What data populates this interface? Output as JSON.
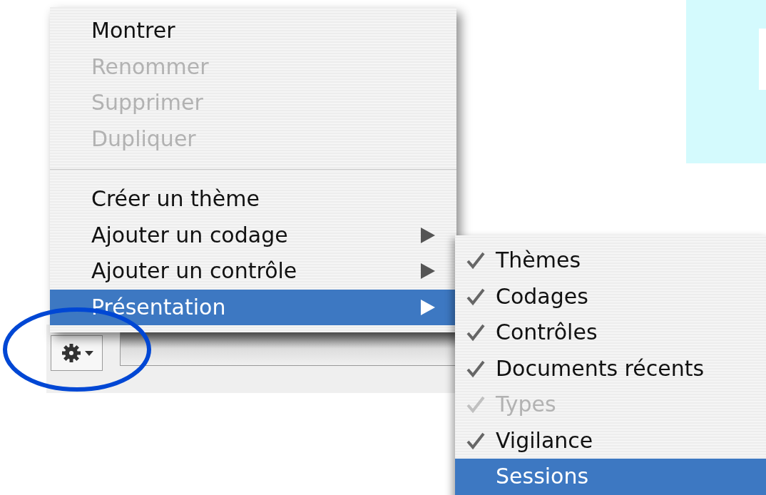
{
  "menu": {
    "items": [
      {
        "kind": "item",
        "label": "Montrer",
        "disabled": false,
        "selected": false,
        "submenu": false
      },
      {
        "kind": "item",
        "label": "Renommer",
        "disabled": true,
        "selected": false,
        "submenu": false
      },
      {
        "kind": "item",
        "label": "Supprimer",
        "disabled": true,
        "selected": false,
        "submenu": false
      },
      {
        "kind": "item",
        "label": "Dupliquer",
        "disabled": true,
        "selected": false,
        "submenu": false
      },
      {
        "kind": "separator"
      },
      {
        "kind": "item",
        "label": "Créer un thème",
        "disabled": false,
        "selected": false,
        "submenu": false
      },
      {
        "kind": "item",
        "label": "Ajouter un codage",
        "disabled": false,
        "selected": false,
        "submenu": true
      },
      {
        "kind": "item",
        "label": "Ajouter un contrôle",
        "disabled": false,
        "selected": false,
        "submenu": true
      },
      {
        "kind": "item",
        "label": "Présentation",
        "disabled": false,
        "selected": true,
        "submenu": true
      }
    ]
  },
  "submenu": {
    "items": [
      {
        "label": "Thèmes",
        "checked": true,
        "disabled": false,
        "selected": false
      },
      {
        "label": "Codages",
        "checked": true,
        "disabled": false,
        "selected": false
      },
      {
        "label": "Contrôles",
        "checked": true,
        "disabled": false,
        "selected": false
      },
      {
        "label": "Documents récents",
        "checked": true,
        "disabled": false,
        "selected": false
      },
      {
        "label": "Types",
        "checked": true,
        "disabled": true,
        "selected": false
      },
      {
        "label": "Vigilance",
        "checked": true,
        "disabled": false,
        "selected": false
      },
      {
        "label": "Sessions",
        "checked": false,
        "disabled": false,
        "selected": true
      }
    ]
  }
}
